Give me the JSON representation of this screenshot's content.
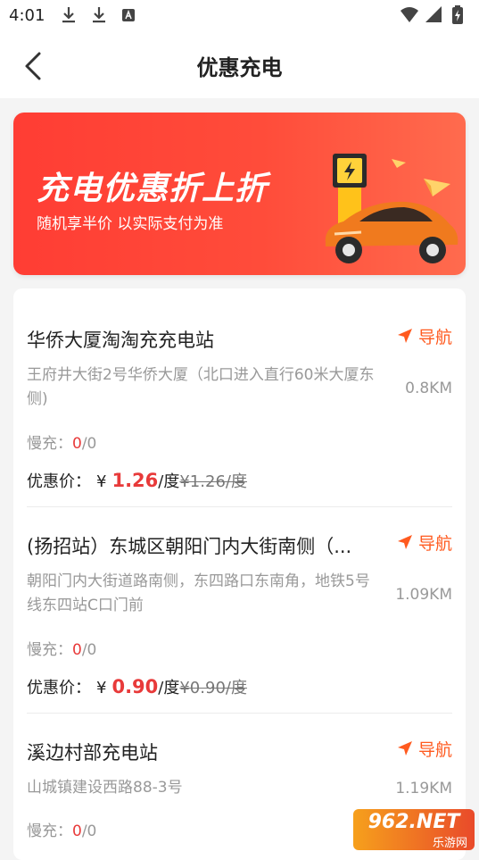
{
  "status_bar": {
    "time": "4:01",
    "icons": [
      "download-icon",
      "download-icon",
      "a-notification-icon",
      "wifi-icon",
      "signal-icon",
      "battery-charging-icon"
    ]
  },
  "header": {
    "back_icon": "chevron-left-icon",
    "title": "优惠充电"
  },
  "banner": {
    "title": "充电优惠折上折",
    "subtitle": "随机享半价 以实际支付为准",
    "colors": {
      "start": "#ff3d34",
      "end": "#ff6b4e"
    }
  },
  "stations": [
    {
      "name": "华侨大厦淘淘充充电站",
      "nav_label": "导航",
      "address": "王府井大街2号华侨大厦（北口进入直行60米大厦东侧)",
      "distance": "0.8KM",
      "slow_label": "慢充：",
      "slow_available": "0",
      "slow_total": "/0",
      "price_label": "优惠价：",
      "currency": "¥",
      "price": "1.26",
      "unit": "/度",
      "original_price": "¥1.26/度"
    },
    {
      "name": "(扬招站）东城区朝阳门内大街南侧（...",
      "nav_label": "导航",
      "address": "朝阳门内大街道路南侧，东四路口东南角，地铁5号线东四站C口门前",
      "distance": "1.09KM",
      "slow_label": "慢充：",
      "slow_available": "0",
      "slow_total": "/0",
      "price_label": "优惠价：",
      "currency": "¥",
      "price": "0.90",
      "unit": "/度",
      "original_price": "¥0.90/度"
    },
    {
      "name": "溪边村部充电站",
      "nav_label": "导航",
      "address": "山城镇建设西路88-3号",
      "distance": "1.19KM",
      "slow_label": "慢充：",
      "slow_available": "0",
      "slow_total": "/0"
    }
  ],
  "accent_colors": {
    "nav": "#ff5a1f",
    "price": "#e83a3a"
  },
  "watermark": {
    "main": "962.NET",
    "sub": "乐游网"
  }
}
